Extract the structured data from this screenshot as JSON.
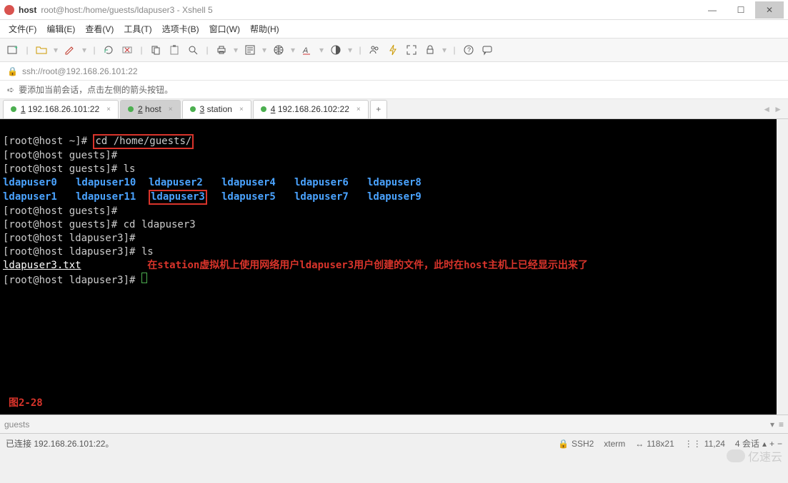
{
  "window": {
    "host_label": "host",
    "title_path": "root@host:/home/guests/ldapuser3 - Xshell 5",
    "min": "—",
    "max": "☐",
    "close": "✕"
  },
  "menu": {
    "file": "文件(F)",
    "edit": "编辑(E)",
    "view": "查看(V)",
    "tools": "工具(T)",
    "tabs": "选项卡(B)",
    "window": "窗口(W)",
    "help": "帮助(H)"
  },
  "addressbar": {
    "url": "ssh://root@192.168.26.101:22"
  },
  "infobar": {
    "text": "要添加当前会话，点击左侧的箭头按钮。"
  },
  "tabs": [
    {
      "num": "1",
      "label": "192.168.26.101:22",
      "active": false
    },
    {
      "num": "2",
      "label": "host",
      "active": true
    },
    {
      "num": "3",
      "label": "station",
      "active": false
    },
    {
      "num": "4",
      "label": "192.168.26.102:22",
      "active": false
    }
  ],
  "tabs_add": "+",
  "terminal": {
    "lines": {
      "l1_prompt": "[root@host ~]# ",
      "l1_cmd": "cd /home/guests/",
      "l2": "[root@host guests]#",
      "l3": "[root@host guests]# ls",
      "ls_row1": [
        "ldapuser0",
        "ldapuser10",
        "ldapuser2",
        "ldapuser4",
        "ldapuser6",
        "ldapuser8"
      ],
      "ls_row2": [
        "ldapuser1",
        "ldapuser11",
        "ldapuser3",
        "ldapuser5",
        "ldapuser7",
        "ldapuser9"
      ],
      "l6": "[root@host guests]#",
      "l7": "[root@host guests]# cd ldapuser3",
      "l8": "[root@host ldapuser3]#",
      "l9": "[root@host ldapuser3]# ls",
      "l10_file": "ldapuser3.txt",
      "l10_annot": "在station虚拟机上使用网络用户ldapuser3用户创建的文件，此时在host主机上已经显示出来了",
      "l11": "[root@host ldapuser3]# "
    },
    "figure_label": "图2-28"
  },
  "bottom_input": {
    "value": "guests"
  },
  "status": {
    "connected": "已连接 192.168.26.101:22。",
    "ssh": "SSH2",
    "term": "xterm",
    "size": "118x21",
    "pos": "11,24",
    "sessions": "4 会话"
  },
  "watermark": "亿速云"
}
